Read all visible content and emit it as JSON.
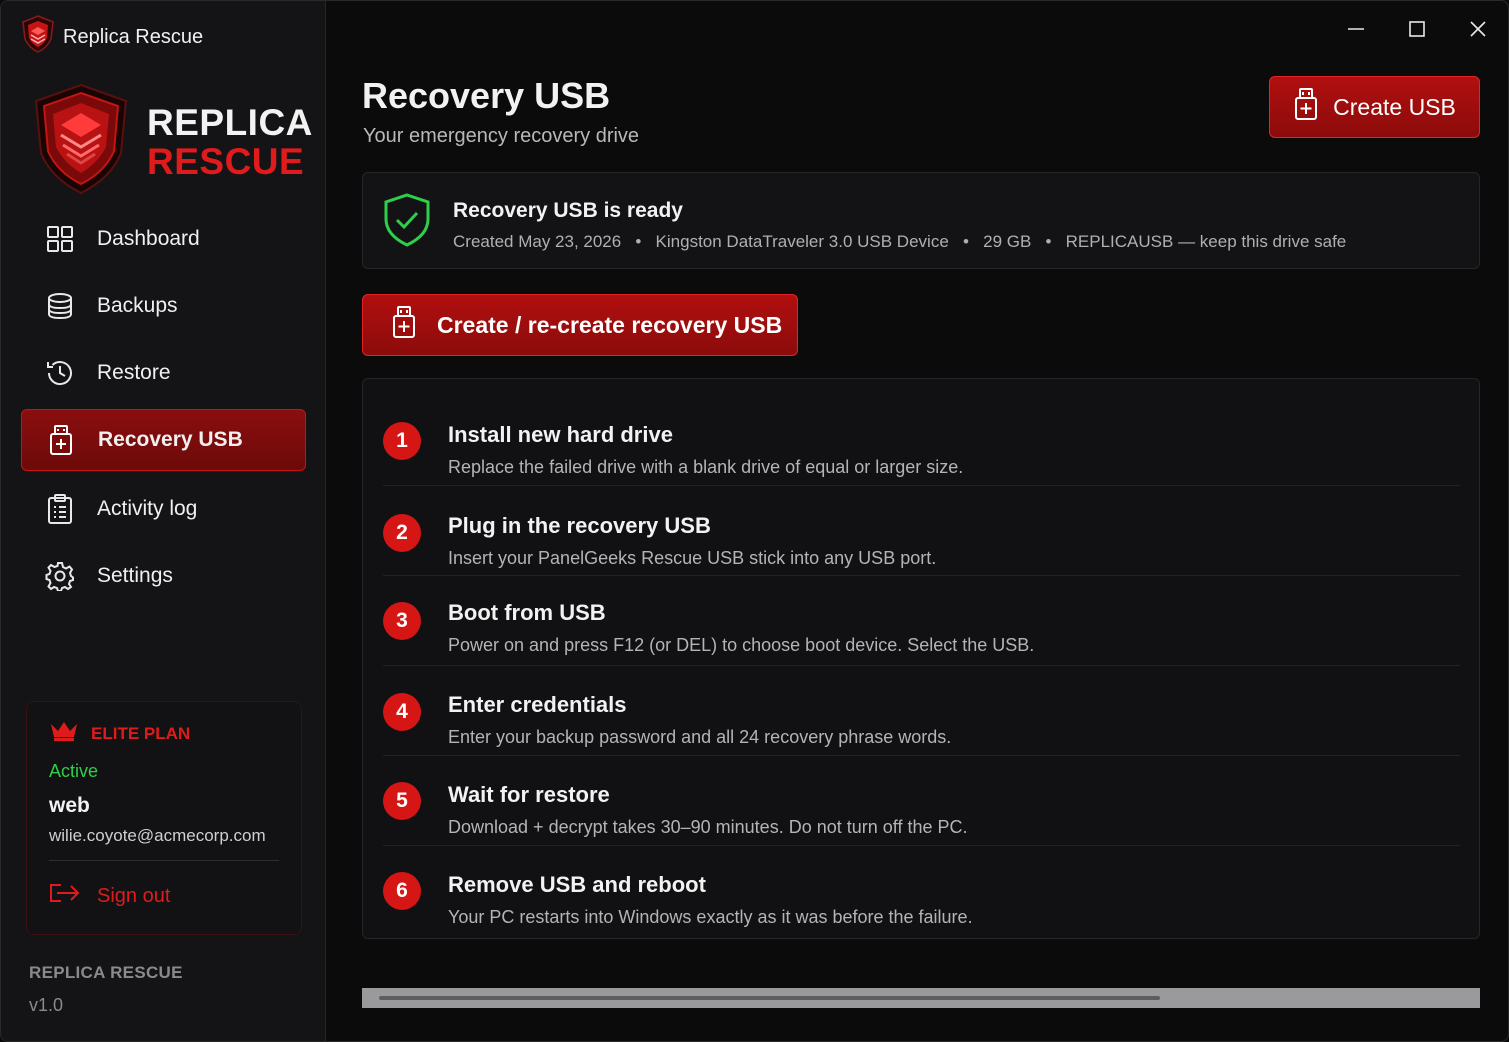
{
  "app": {
    "window_title": "Replica Rescue",
    "brand_line1": "REPLICA",
    "brand_line2": "RESCUE"
  },
  "sidebar": {
    "items": [
      {
        "label": "Dashboard",
        "icon": "grid-icon"
      },
      {
        "label": "Backups",
        "icon": "database-icon"
      },
      {
        "label": "Restore",
        "icon": "history-icon"
      },
      {
        "label": "Recovery USB",
        "icon": "usb-icon",
        "active": true
      },
      {
        "label": "Activity log",
        "icon": "clipboard-icon"
      },
      {
        "label": "Settings",
        "icon": "gear-icon"
      }
    ],
    "plan": {
      "name": "ELITE PLAN",
      "status": "Active",
      "user": "web",
      "email": "wilie.coyote@acmecorp.com",
      "signout": "Sign out"
    },
    "footer": {
      "name": "REPLICA RESCUE",
      "version": "v1.0"
    }
  },
  "main": {
    "title": "Recovery USB",
    "subtitle": "Your emergency recovery drive",
    "create_button": "Create USB",
    "ready": {
      "title": "Recovery USB is ready",
      "created": "Created May 23, 2026",
      "device": "Kingston DataTraveler 3.0 USB Device",
      "size": "29 GB",
      "label": "REPLICAUSB — keep this drive safe"
    },
    "recreate_button": "Create / re-create recovery USB",
    "steps": [
      {
        "num": "1",
        "title": "Install new hard drive",
        "desc": "Replace the failed drive with a blank drive of equal or larger size."
      },
      {
        "num": "2",
        "title": "Plug in the recovery USB",
        "desc": "Insert your PanelGeeks Rescue USB stick into any USB port."
      },
      {
        "num": "3",
        "title": "Boot from USB",
        "desc": "Power on and press F12 (or DEL) to choose boot device. Select the USB."
      },
      {
        "num": "4",
        "title": "Enter credentials",
        "desc": "Enter your backup password and all 24 recovery phrase words."
      },
      {
        "num": "5",
        "title": "Wait for restore",
        "desc": "Download + decrypt takes 30–90 minutes. Do not turn off the PC."
      },
      {
        "num": "6",
        "title": "Remove USB and reboot",
        "desc": "Your PC restarts into Windows exactly as it was before the failure."
      }
    ]
  },
  "colors": {
    "accent": "#e01b1b",
    "accent_dark": "#8c0b0b",
    "success": "#2fcf4a",
    "background": "#0b0b0c",
    "sidebar": "#141416"
  }
}
